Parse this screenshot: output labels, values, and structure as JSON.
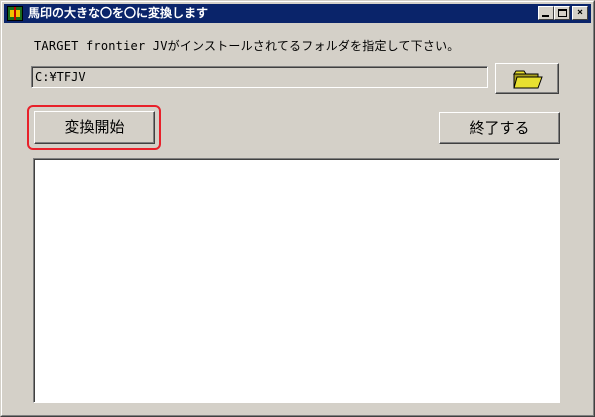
{
  "window": {
    "title": "馬印の大きな〇を〇に変換します",
    "icon": "app-icon",
    "controls": {
      "minimize_icon": "minimize-icon",
      "maximize_icon": "maximize-icon",
      "close_label": "×"
    }
  },
  "instruction": {
    "text": "TARGET frontier JVがインストールされてるフォルダを指定して下さい。"
  },
  "folder_path": {
    "value": "C:¥TFJV"
  },
  "browse_button": {
    "icon": "folder-icon"
  },
  "buttons": {
    "start_label": "変換開始",
    "exit_label": "終了する"
  },
  "log": {
    "value": ""
  },
  "colors": {
    "titlebar": "#0a246a",
    "window_bg": "#d4d0c8",
    "highlight": "#e8202a",
    "folder": "#e8e030"
  }
}
